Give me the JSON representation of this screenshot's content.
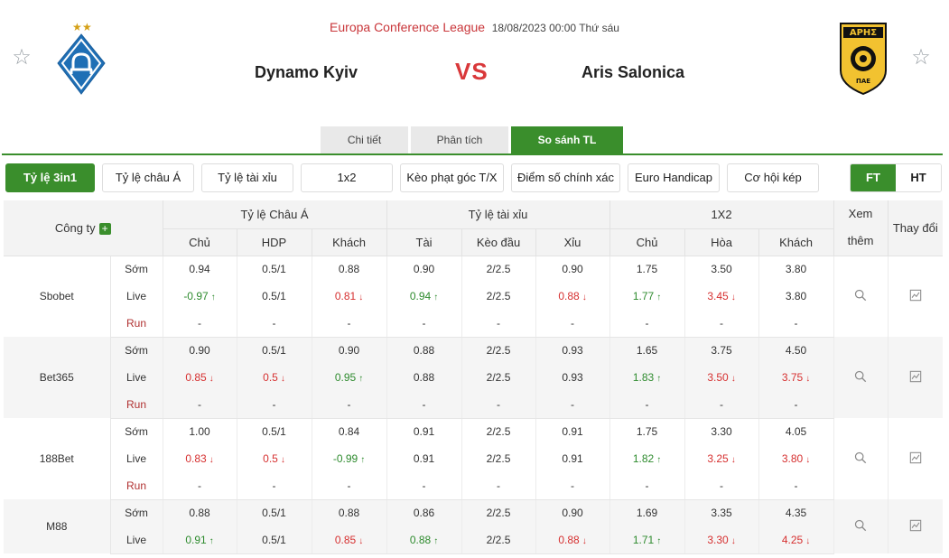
{
  "match": {
    "league": "Europa Conference League",
    "datetime": "18/08/2023 00:00 Thứ sáu",
    "home": "Dynamo Kyiv",
    "away": "Aris Salonica",
    "vs": "VS",
    "away_logo_text": "ΑΡΗΣ",
    "away_logo_sub": "ΠΑΕ"
  },
  "tabs": [
    {
      "label": "Chi tiết",
      "active": false
    },
    {
      "label": "Phân tích",
      "active": false
    },
    {
      "label": "So sánh TL",
      "active": true
    }
  ],
  "filters": [
    {
      "label": "Tỷ lệ 3in1",
      "active": true
    },
    {
      "label": "Tỷ lệ châu Á",
      "active": false
    },
    {
      "label": "Tỷ lệ tài xỉu",
      "active": false
    },
    {
      "label": "1x2",
      "active": false
    },
    {
      "label": "Kèo phạt góc T/X",
      "active": false
    },
    {
      "label": "Điểm số chính xác",
      "active": false
    },
    {
      "label": "Euro Handicap",
      "active": false
    },
    {
      "label": "Cơ hội kép",
      "active": false
    }
  ],
  "period_toggle": [
    {
      "label": "FT",
      "active": true
    },
    {
      "label": "HT",
      "active": false
    }
  ],
  "table": {
    "company_header": "Công ty",
    "groups": [
      "Tỷ lệ Châu Á",
      "Tỷ lệ tài xỉu",
      "1X2"
    ],
    "view_header": "Xem thêm",
    "change_header": "Thay đổi",
    "subheaders": [
      "Chủ",
      "HDP",
      "Khách",
      "Tài",
      "Kèo đầu",
      "Xỉu",
      "Chủ",
      "Hòa",
      "Khách"
    ],
    "companies": [
      {
        "name": "Sbobet",
        "rows": [
          {
            "kind": "Sớm",
            "cells": [
              {
                "v": "0.94",
                "t": ""
              },
              {
                "v": "0.5/1",
                "t": ""
              },
              {
                "v": "0.88",
                "t": ""
              },
              {
                "v": "0.90",
                "t": ""
              },
              {
                "v": "2/2.5",
                "t": ""
              },
              {
                "v": "0.90",
                "t": ""
              },
              {
                "v": "1.75",
                "t": ""
              },
              {
                "v": "3.50",
                "t": ""
              },
              {
                "v": "3.80",
                "t": ""
              }
            ]
          },
          {
            "kind": "Live",
            "cells": [
              {
                "v": "-0.97",
                "t": "up"
              },
              {
                "v": "0.5/1",
                "t": ""
              },
              {
                "v": "0.81",
                "t": "down"
              },
              {
                "v": "0.94",
                "t": "up"
              },
              {
                "v": "2/2.5",
                "t": ""
              },
              {
                "v": "0.88",
                "t": "down"
              },
              {
                "v": "1.77",
                "t": "up"
              },
              {
                "v": "3.45",
                "t": "down"
              },
              {
                "v": "3.80",
                "t": ""
              }
            ]
          },
          {
            "kind": "Run",
            "cells": [
              {
                "v": "-",
                "t": ""
              },
              {
                "v": "-",
                "t": ""
              },
              {
                "v": "-",
                "t": ""
              },
              {
                "v": "-",
                "t": ""
              },
              {
                "v": "-",
                "t": ""
              },
              {
                "v": "-",
                "t": ""
              },
              {
                "v": "-",
                "t": ""
              },
              {
                "v": "-",
                "t": ""
              },
              {
                "v": "-",
                "t": ""
              }
            ]
          }
        ]
      },
      {
        "name": "Bet365",
        "rows": [
          {
            "kind": "Sớm",
            "cells": [
              {
                "v": "0.90",
                "t": ""
              },
              {
                "v": "0.5/1",
                "t": ""
              },
              {
                "v": "0.90",
                "t": ""
              },
              {
                "v": "0.88",
                "t": ""
              },
              {
                "v": "2/2.5",
                "t": ""
              },
              {
                "v": "0.93",
                "t": ""
              },
              {
                "v": "1.65",
                "t": ""
              },
              {
                "v": "3.75",
                "t": ""
              },
              {
                "v": "4.50",
                "t": ""
              }
            ]
          },
          {
            "kind": "Live",
            "cells": [
              {
                "v": "0.85",
                "t": "down"
              },
              {
                "v": "0.5",
                "t": "down"
              },
              {
                "v": "0.95",
                "t": "up"
              },
              {
                "v": "0.88",
                "t": ""
              },
              {
                "v": "2/2.5",
                "t": ""
              },
              {
                "v": "0.93",
                "t": ""
              },
              {
                "v": "1.83",
                "t": "up"
              },
              {
                "v": "3.50",
                "t": "down"
              },
              {
                "v": "3.75",
                "t": "down"
              }
            ]
          },
          {
            "kind": "Run",
            "cells": [
              {
                "v": "-",
                "t": ""
              },
              {
                "v": "-",
                "t": ""
              },
              {
                "v": "-",
                "t": ""
              },
              {
                "v": "-",
                "t": ""
              },
              {
                "v": "-",
                "t": ""
              },
              {
                "v": "-",
                "t": ""
              },
              {
                "v": "-",
                "t": ""
              },
              {
                "v": "-",
                "t": ""
              },
              {
                "v": "-",
                "t": ""
              }
            ]
          }
        ]
      },
      {
        "name": "188Bet",
        "rows": [
          {
            "kind": "Sớm",
            "cells": [
              {
                "v": "1.00",
                "t": ""
              },
              {
                "v": "0.5/1",
                "t": ""
              },
              {
                "v": "0.84",
                "t": ""
              },
              {
                "v": "0.91",
                "t": ""
              },
              {
                "v": "2/2.5",
                "t": ""
              },
              {
                "v": "0.91",
                "t": ""
              },
              {
                "v": "1.75",
                "t": ""
              },
              {
                "v": "3.30",
                "t": ""
              },
              {
                "v": "4.05",
                "t": ""
              }
            ]
          },
          {
            "kind": "Live",
            "cells": [
              {
                "v": "0.83",
                "t": "down"
              },
              {
                "v": "0.5",
                "t": "down"
              },
              {
                "v": "-0.99",
                "t": "up"
              },
              {
                "v": "0.91",
                "t": ""
              },
              {
                "v": "2/2.5",
                "t": ""
              },
              {
                "v": "0.91",
                "t": ""
              },
              {
                "v": "1.82",
                "t": "up"
              },
              {
                "v": "3.25",
                "t": "down"
              },
              {
                "v": "3.80",
                "t": "down"
              }
            ]
          },
          {
            "kind": "Run",
            "cells": [
              {
                "v": "-",
                "t": ""
              },
              {
                "v": "-",
                "t": ""
              },
              {
                "v": "-",
                "t": ""
              },
              {
                "v": "-",
                "t": ""
              },
              {
                "v": "-",
                "t": ""
              },
              {
                "v": "-",
                "t": ""
              },
              {
                "v": "-",
                "t": ""
              },
              {
                "v": "-",
                "t": ""
              },
              {
                "v": "-",
                "t": ""
              }
            ]
          }
        ]
      },
      {
        "name": "M88",
        "rows": [
          {
            "kind": "Sớm",
            "cells": [
              {
                "v": "0.88",
                "t": ""
              },
              {
                "v": "0.5/1",
                "t": ""
              },
              {
                "v": "0.88",
                "t": ""
              },
              {
                "v": "0.86",
                "t": ""
              },
              {
                "v": "2/2.5",
                "t": ""
              },
              {
                "v": "0.90",
                "t": ""
              },
              {
                "v": "1.69",
                "t": ""
              },
              {
                "v": "3.35",
                "t": ""
              },
              {
                "v": "4.35",
                "t": ""
              }
            ]
          },
          {
            "kind": "Live",
            "cells": [
              {
                "v": "0.91",
                "t": "up"
              },
              {
                "v": "0.5/1",
                "t": ""
              },
              {
                "v": "0.85",
                "t": "down"
              },
              {
                "v": "0.88",
                "t": "up"
              },
              {
                "v": "2/2.5",
                "t": ""
              },
              {
                "v": "0.88",
                "t": "down"
              },
              {
                "v": "1.71",
                "t": "up"
              },
              {
                "v": "3.30",
                "t": "down"
              },
              {
                "v": "4.25",
                "t": "down"
              }
            ]
          }
        ]
      }
    ]
  },
  "colors": {
    "accent": "#3a8e2c",
    "up": "#2e8b2e",
    "down": "#d63030",
    "league": "#c9363a",
    "vs": "#d9383a"
  },
  "icons": {
    "favorite": "star-outline-icon",
    "add": "plus-icon",
    "view": "magnifier-icon",
    "change": "line-chart-icon",
    "up": "arrow-up-icon",
    "down": "arrow-down-icon"
  }
}
